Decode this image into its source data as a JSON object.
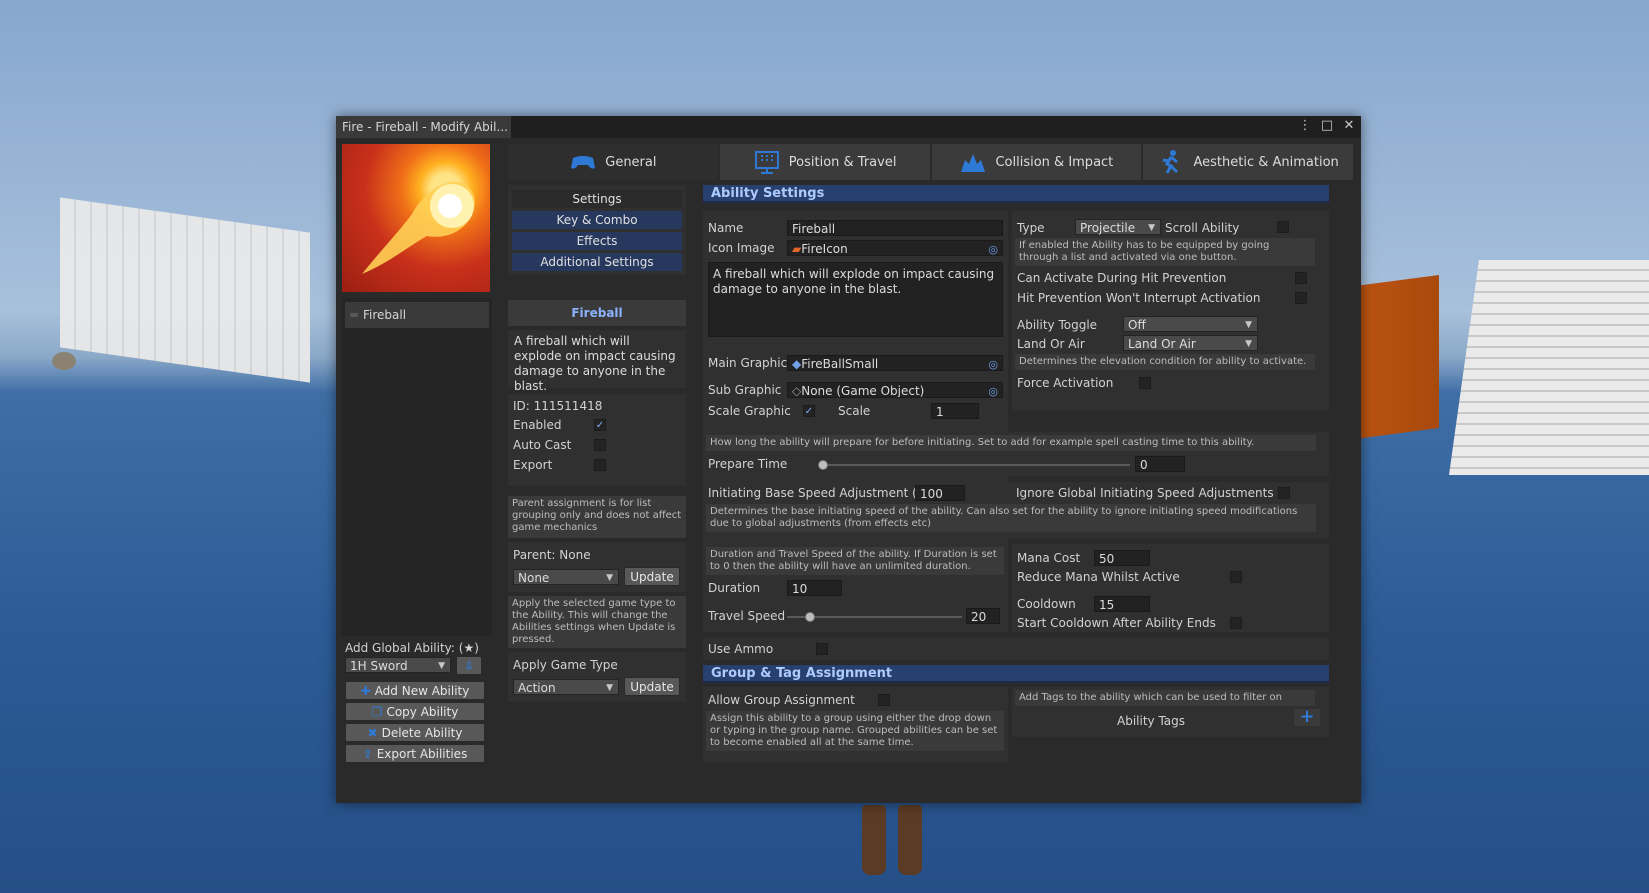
{
  "window": {
    "title": "Fire - Fireball - Modify Abil...",
    "icons": {
      "menu": "⋮",
      "maximize": "□",
      "close": "✕"
    }
  },
  "left": {
    "selected_ability": "Fireball",
    "add_global_label": "Add Global Ability: (★)",
    "global_dropdown": "1H Sword",
    "buttons": {
      "add": "Add New Ability",
      "copy": "Copy Ability",
      "delete": "Delete Ability",
      "export": "Export Abilities"
    }
  },
  "tabs": [
    {
      "label": "General",
      "icon": "gamepad-icon"
    },
    {
      "label": "Position & Travel",
      "icon": "grid-board-icon"
    },
    {
      "label": "Collision & Impact",
      "icon": "impact-icon"
    },
    {
      "label": "Aesthetic & Animation",
      "icon": "running-figure-icon"
    }
  ],
  "menu": [
    "Settings",
    "Key & Combo",
    "Effects",
    "Additional Settings"
  ],
  "middle": {
    "name_header": "Fireball",
    "description": "A fireball which will explode on impact causing damage to anyone in the blast.",
    "id_label": "ID: 111511418",
    "enabled_label": "Enabled",
    "autocast_label": "Auto Cast",
    "export_label": "Export",
    "parent_help": "Parent assignment is for list grouping only and does not affect game mechanics",
    "parent_label": "Parent: None",
    "parent_dropdown": "None",
    "update": "Update",
    "game_type_help": "Apply the selected game type to the Ability. This will change the Abilities settings when Update is pressed.",
    "apply_game_type_label": "Apply Game Type",
    "game_type_dropdown": "Action"
  },
  "settings": {
    "section_title": "Ability Settings",
    "name_label": "Name",
    "name_value": "Fireball",
    "icon_image_label": "Icon Image",
    "icon_image_value": "FireIcon",
    "description_value": "A fireball which will explode on impact causing damage to anyone in the blast.",
    "main_graphic_label": "Main Graphic",
    "main_graphic_value": "FireBallSmall",
    "sub_graphic_label": "Sub Graphic",
    "sub_graphic_value": "None (Game Object)",
    "scale_graphic_label": "Scale Graphic",
    "scale_label": "Scale",
    "scale_value": "1",
    "type_label": "Type",
    "type_value": "Projectile",
    "scroll_label": "Scroll Ability",
    "scroll_help": "If enabled the Ability has to be equipped by going through a list and activated via one button.",
    "can_activate_label": "Can Activate During Hit Prevention",
    "hit_prevention_label": "Hit Prevention Won't Interrupt Activation",
    "toggle_label": "Ability Toggle",
    "toggle_value": "Off",
    "land_air_label": "Land Or Air",
    "land_air_value": "Land Or Air",
    "land_air_help": "Determines the elevation condition for ability to activate.",
    "force_label": "Force Activation",
    "prepare_help": "How long the ability will prepare for before initiating. Set to add for example spell casting time to this ability.",
    "prepare_label": "Prepare Time",
    "prepare_value": "0",
    "prepare_slider": 0,
    "init_speed_label": "Initiating Base Speed Adjustment (%)",
    "init_speed_value": "100",
    "ignore_global_label": "Ignore Global Initiating Speed Adjustments",
    "init_help": "Determines the base initiating speed of the ability. Can also set for the ability to ignore initiating speed modifications due to global adjustments (from effects etc)",
    "duration_help": "Duration and Travel Speed of the ability. If Duration is set to 0 then the ability will have an unlimited duration.",
    "duration_label": "Duration",
    "duration_value": "10",
    "travel_label": "Travel Speed",
    "travel_value": "20",
    "travel_slider": 0.1,
    "mana_label": "Mana Cost",
    "mana_value": "50",
    "reduce_mana_label": "Reduce Mana Whilst Active",
    "cooldown_label": "Cooldown",
    "cooldown_value": "15",
    "start_cooldown_label": "Start Cooldown After Ability Ends",
    "use_ammo_label": "Use Ammo"
  },
  "group": {
    "section_title": "Group & Tag Assignment",
    "allow_group_label": "Allow Group Assignment",
    "group_help": "Assign this ability to a group using either the drop down or typing in the group name. Grouped abilities can be set to become enabled all at the same time.",
    "tags_help": "Add Tags to the ability which can be used to filter on",
    "tags_label": "Ability Tags"
  },
  "colors": {
    "accent": "#2f79d6",
    "section": "#28406e",
    "panel": "#303030"
  }
}
